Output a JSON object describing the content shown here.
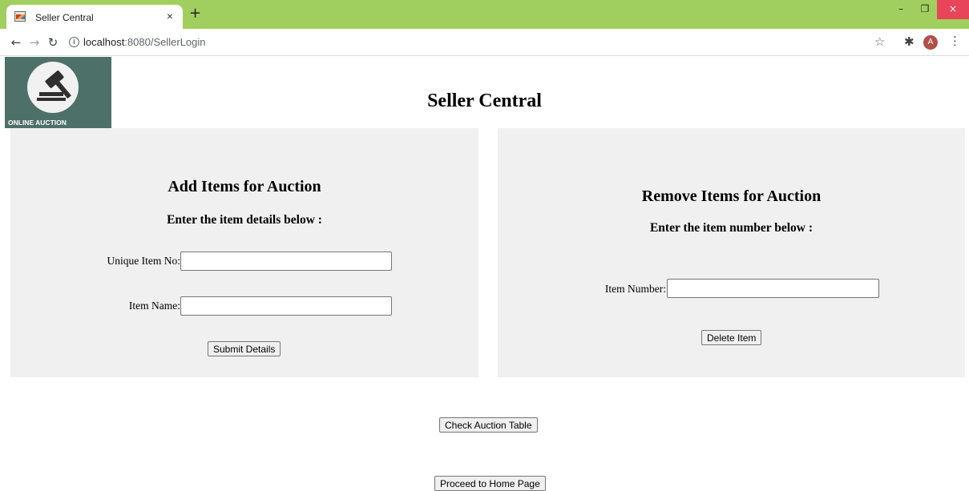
{
  "browser": {
    "tab_title": "Seller Central",
    "tab_close": "×",
    "new_tab": "+",
    "url_host": "localhost",
    "url_path": ":8080/SellerLogin",
    "profile_initial": "A",
    "window_controls": {
      "minimize": "–",
      "restore": "❐",
      "close": "×"
    }
  },
  "logo": {
    "text": "ONLINE AUCTION"
  },
  "page": {
    "title": "Seller Central"
  },
  "add_panel": {
    "heading": "Add Items for Auction",
    "subheading": "Enter the item details below :",
    "item_no_label": "Unique Item No:",
    "item_no_value": "",
    "item_name_label": "Item Name:",
    "item_name_value": "",
    "submit_label": "Submit Details"
  },
  "remove_panel": {
    "heading": "Remove Items for Auction",
    "subheading": "Enter the item number below :",
    "item_number_label": "Item Number:",
    "item_number_value": "",
    "delete_label": "Delete Item"
  },
  "actions": {
    "check_table_label": "Check Auction Table",
    "home_label": "Proceed to Home Page"
  },
  "colors": {
    "tabbar": "#a1cf5f",
    "panel_bg": "#f0f0f0",
    "logo_bg": "#4d7068",
    "close_button": "#e8445a"
  },
  "icons": [
    "favicon-icon",
    "close-icon",
    "plus-icon",
    "back-arrow-icon",
    "forward-arrow-icon",
    "reload-icon",
    "info-icon",
    "star-icon",
    "extensions-icon",
    "menu-icon",
    "gavel-icon"
  ]
}
